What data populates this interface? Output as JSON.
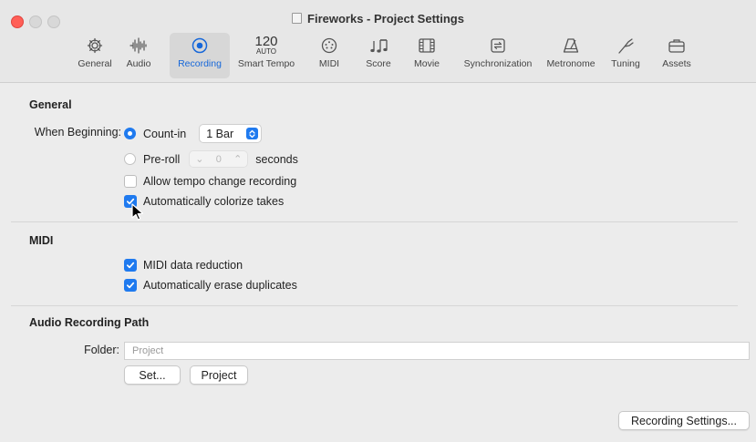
{
  "window": {
    "title": "Fireworks - Project Settings"
  },
  "toolbar": {
    "items": [
      {
        "label": "General",
        "icon": "gear-icon"
      },
      {
        "label": "Audio",
        "icon": "waveform-icon"
      },
      {
        "label": "Recording",
        "icon": "record-icon",
        "active": true
      },
      {
        "label": "Smart Tempo",
        "icon": "tempo-icon",
        "tempo_value": "120",
        "tempo_mode": "AUTO"
      },
      {
        "label": "MIDI",
        "icon": "midi-port-icon"
      },
      {
        "label": "Score",
        "icon": "notes-icon"
      },
      {
        "label": "Movie",
        "icon": "film-icon"
      },
      {
        "label": "Synchronization",
        "icon": "sync-icon"
      },
      {
        "label": "Metronome",
        "icon": "metronome-icon"
      },
      {
        "label": "Tuning",
        "icon": "tuning-fork-icon"
      },
      {
        "label": "Assets",
        "icon": "briefcase-icon"
      }
    ]
  },
  "general": {
    "heading": "General",
    "when_beginning_label": "When Beginning:",
    "count_in_label": "Count-in",
    "count_in_selected": true,
    "count_in_value": "1 Bar",
    "pre_roll_label": "Pre-roll",
    "pre_roll_selected": false,
    "pre_roll_value": "0",
    "pre_roll_unit": "seconds",
    "allow_tempo_label": "Allow tempo change recording",
    "allow_tempo_checked": false,
    "colorize_label": "Automatically colorize takes",
    "colorize_checked": true
  },
  "midi": {
    "heading": "MIDI",
    "data_reduction_label": "MIDI data reduction",
    "data_reduction_checked": true,
    "erase_duplicates_label": "Automatically erase duplicates",
    "erase_duplicates_checked": true
  },
  "audio_path": {
    "heading": "Audio Recording Path",
    "folder_label": "Folder:",
    "folder_placeholder": "Project",
    "set_button": "Set...",
    "project_button": "Project"
  },
  "footer": {
    "recording_settings_button": "Recording Settings..."
  },
  "colors": {
    "accent": "#1f7aef",
    "close": "#ff5f57",
    "active_label": "#1667d9"
  }
}
